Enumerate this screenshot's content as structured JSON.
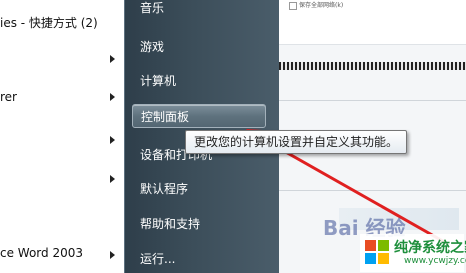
{
  "left_menu": {
    "items": [
      {
        "label": "ies - 快捷方式 (2)",
        "has_arrow": false
      },
      {
        "label": "",
        "has_arrow": true
      },
      {
        "label": "rer",
        "has_arrow": true
      },
      {
        "label": "",
        "has_arrow": true
      },
      {
        "label": "",
        "has_arrow": true
      },
      {
        "label": "ce Word 2003",
        "has_arrow": true
      }
    ]
  },
  "start_menu": {
    "items": [
      {
        "label": "音乐"
      },
      {
        "label": "游戏"
      },
      {
        "label": "计算机"
      },
      {
        "label": "控制面板"
      },
      {
        "label": "设备和打印机"
      },
      {
        "label": "默认程序"
      },
      {
        "label": "帮助和支持"
      },
      {
        "label": "运行..."
      }
    ],
    "highlighted_index": 3
  },
  "tooltip": {
    "text": "更改您的计算机设置并自定义其功能。"
  },
  "background_window": {
    "checkbox_label": "保存全部网络(k)"
  },
  "watermark": {
    "baidu": "Bai 经验",
    "title": "纯净系统之家",
    "url": "www.ycwjzy.com"
  },
  "colors": {
    "arrow": "#e02020",
    "menu_bg": "#3c4e5a",
    "watermark_green": "#1e8f3c"
  }
}
